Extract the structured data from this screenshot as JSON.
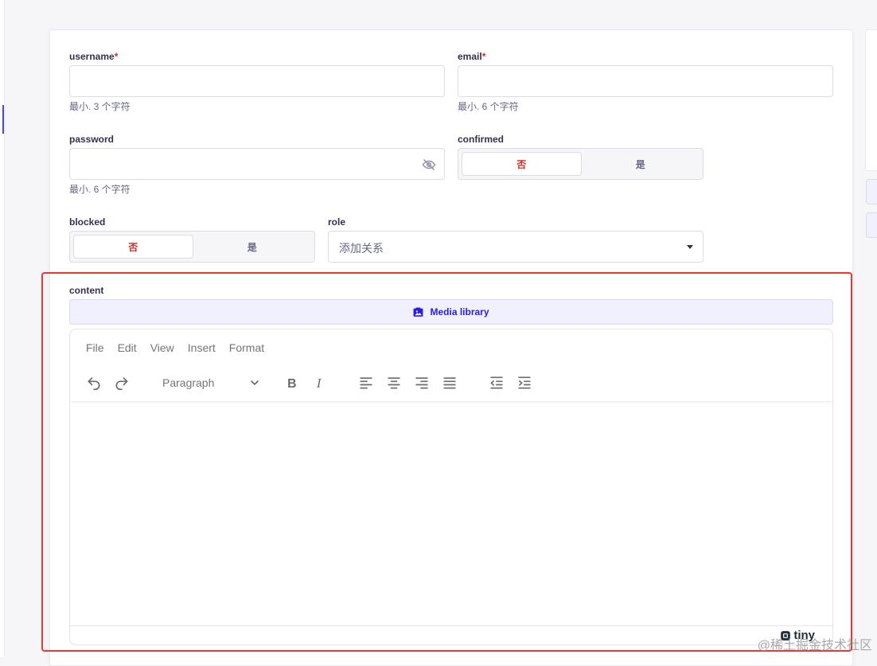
{
  "form": {
    "username": {
      "label": "username",
      "required_mark": "*",
      "value": "",
      "hint": "最小. 3 个字符"
    },
    "email": {
      "label": "email",
      "required_mark": "*",
      "value": "",
      "hint": "最小. 6 个字符"
    },
    "password": {
      "label": "password",
      "value": "",
      "hint": "最小. 6 个字符"
    },
    "confirmed": {
      "label": "confirmed",
      "option_no": "否",
      "option_yes": "是",
      "selected": "否"
    },
    "blocked": {
      "label": "blocked",
      "option_no": "否",
      "option_yes": "是",
      "selected": "否"
    },
    "role": {
      "label": "role",
      "placeholder": "添加关系"
    },
    "content": {
      "label": "content",
      "media_library_label": "Media library"
    }
  },
  "editor": {
    "menu": [
      "File",
      "Edit",
      "View",
      "Insert",
      "Format"
    ],
    "block_format": "Paragraph",
    "toolbar_icons": [
      "undo-icon",
      "redo-icon",
      "bold-icon",
      "italic-icon",
      "align-left-icon",
      "align-center-icon",
      "align-right-icon",
      "align-justify-icon",
      "outdent-icon",
      "indent-icon"
    ],
    "brand": "tiny"
  },
  "watermark": "@稀土掘金技术社区",
  "colors": {
    "accent": "#4945ff",
    "danger": "#d02b20",
    "highlight": "#e53935"
  }
}
